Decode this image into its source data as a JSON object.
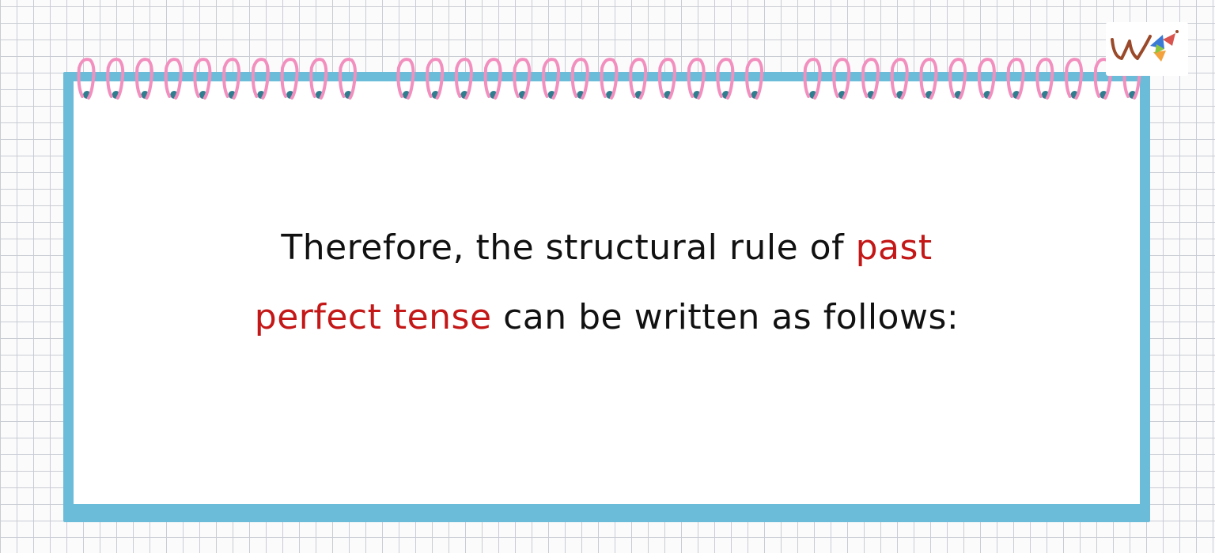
{
  "lesson": {
    "line1_text": "Therefore, the structural rule of",
    "line1_highlight": "past",
    "line2_highlight": "perfect tense",
    "line2_text": "can be written as follows:"
  },
  "colors": {
    "highlight": "#c41717",
    "notebook_border": "#6bbcd8",
    "ring_pink": "#f28fbe",
    "hole_teal": "#2f7e8f"
  },
  "logo": {
    "icon": "w-logo-icon"
  }
}
